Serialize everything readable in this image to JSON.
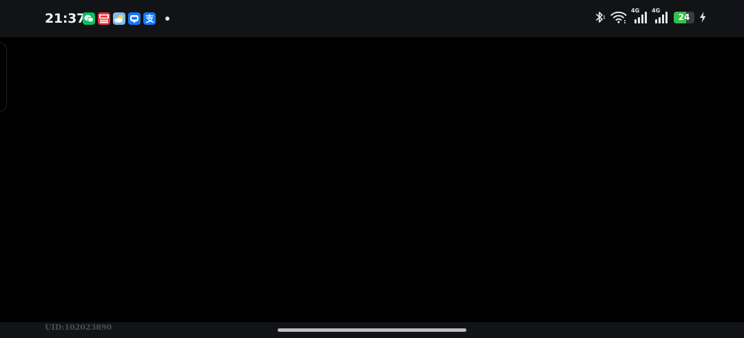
{
  "status_bar": {
    "time": "21:37",
    "notifications": [
      {
        "app": "wechat",
        "icon": "wechat-icon",
        "color": "#07c160"
      },
      {
        "app": "shopping",
        "icon": "shopping-app-icon",
        "color": "#e8323b"
      },
      {
        "app": "weather",
        "icon": "weather-icon",
        "color": "#5ba7e8"
      },
      {
        "app": "messenger",
        "icon": "messenger-icon",
        "color": "#1677ff"
      },
      {
        "app": "alipay",
        "icon": "alipay-icon",
        "color": "#1677ff"
      }
    ],
    "more_notifications_icon": "more-dot-icon",
    "network_type_1": "4G",
    "network_type_2": "4G",
    "battery_level": "24",
    "battery_fraction": 0.24,
    "charging": true,
    "battery_color": "#35c24a"
  },
  "bottom_bar": {
    "uid_label": "UID:102023890"
  }
}
